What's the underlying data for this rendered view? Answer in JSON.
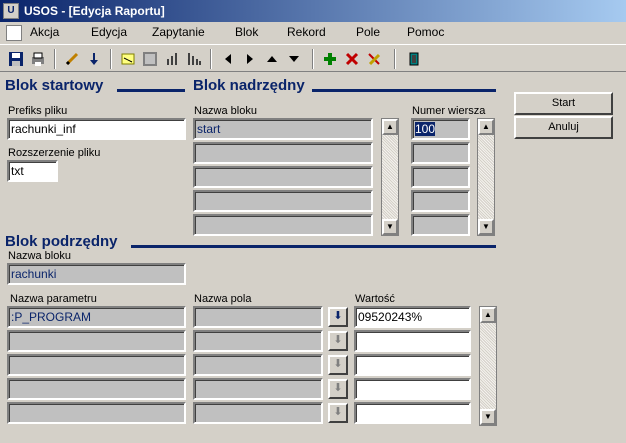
{
  "window": {
    "title": "USOS - [Edycja Raportu]"
  },
  "menu": [
    "Akcja",
    "Edycja",
    "Zapytanie",
    "Blok",
    "Rekord",
    "Pole",
    "Pomoc"
  ],
  "toolbar": {
    "icons": [
      "save-icon",
      "print-icon",
      "edit-icon",
      "download-icon",
      "query-icon",
      "grid-icon",
      "bar-chart-icon",
      "bar-chart-alt-icon",
      "prev-icon",
      "next-icon",
      "up-icon",
      "down-icon",
      "insert-icon",
      "delete-icon",
      "clear-icon",
      "exit-icon"
    ]
  },
  "blok_startowy": {
    "title": "Blok startowy",
    "prefix_label": "Prefiks pliku",
    "prefix_value": "rachunki_inf",
    "ext_label": "Rozszerzenie pliku",
    "ext_value": "txt"
  },
  "blok_nadrzedny": {
    "title": "Blok nadrzędny",
    "name_label": "Nazwa bloku",
    "row_label": "Numer wiersza",
    "rows": [
      {
        "name": "start",
        "row": "100"
      },
      {
        "name": "",
        "row": ""
      },
      {
        "name": "",
        "row": ""
      },
      {
        "name": "",
        "row": ""
      },
      {
        "name": "",
        "row": ""
      }
    ]
  },
  "blok_podrzedny": {
    "title": "Blok podrzędny",
    "name_label": "Nazwa bloku",
    "name_value": "rachunki",
    "param_label": "Nazwa parametru",
    "field_label": "Nazwa pola",
    "value_label": "Wartość",
    "rows": [
      {
        "param": ":P_PROGRAM",
        "field": "",
        "value": "09520243%"
      },
      {
        "param": "",
        "field": "",
        "value": ""
      },
      {
        "param": "",
        "field": "",
        "value": ""
      },
      {
        "param": "",
        "field": "",
        "value": ""
      },
      {
        "param": "",
        "field": "",
        "value": ""
      }
    ]
  },
  "buttons": {
    "start": "Start",
    "cancel": "Anuluj"
  }
}
